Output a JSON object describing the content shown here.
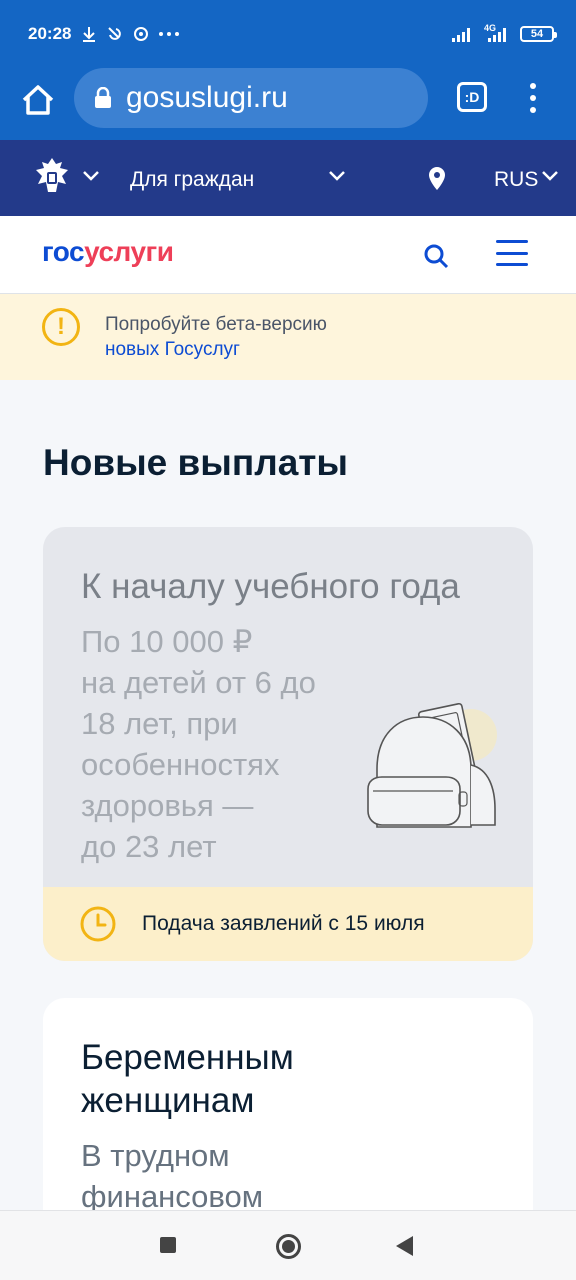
{
  "status_bar": {
    "time": "20:28",
    "battery": "54",
    "network": "4G"
  },
  "browser": {
    "url": "gosuslugi.ru",
    "tab_label": ":D"
  },
  "gov_nav": {
    "section": "Для граждан",
    "language": "RUS"
  },
  "header": {
    "logo_part1": "гос",
    "logo_part2": "услуги"
  },
  "beta_banner": {
    "text": "Попробуйте бета-версию",
    "link": "новых Госуслуг",
    "icon_symbol": "!"
  },
  "main": {
    "title": "Новые выплаты",
    "cards": [
      {
        "title": "К началу учебного года",
        "description": "По 10 000 ₽\nна детей от 6 до\n18 лет, при\nособенностях\nздоровья —\nдо 23 лет",
        "footer": "Подача заявлений с 15 июля"
      },
      {
        "title": "Беременным\nженщинам",
        "description": "В трудном\nфинансовом"
      }
    ]
  },
  "colors": {
    "primary": "#1466c4",
    "nav": "#233a8a",
    "brand_blue": "#0d4cd3",
    "brand_red": "#ee3f58",
    "warning": "#f2b413"
  }
}
